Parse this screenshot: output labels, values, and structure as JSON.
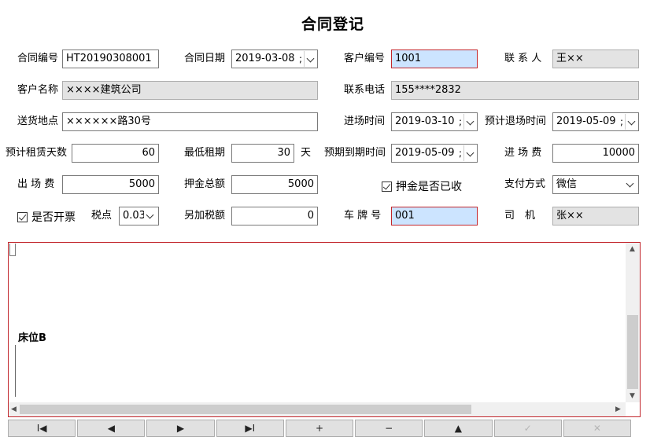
{
  "form": {
    "title": "合同登记",
    "contract_no": {
      "label": "合同编号",
      "value": "HT20190308001"
    },
    "contract_date": {
      "label": "合同日期",
      "value": "2019-03-08"
    },
    "customer_no": {
      "label": "客户编号",
      "value": "1001"
    },
    "contact": {
      "label": "联 系 人",
      "value": "王××"
    },
    "customer_name": {
      "label": "客户名称",
      "value": "××××建筑公司"
    },
    "phone": {
      "label": "联系电话",
      "value": "155****2832"
    },
    "address": {
      "label": "送货地点",
      "value": "××××××路30号"
    },
    "entry_time": {
      "label": "进场时间",
      "value": "2019-03-10"
    },
    "planned_exit": {
      "label": "预计退场时间",
      "value": "2019-05-09"
    },
    "rent_days": {
      "label": "预计租赁天数",
      "value": "60"
    },
    "min_rent": {
      "label": "最低租期",
      "value": "30",
      "unit": "天"
    },
    "due_date": {
      "label": "预期到期时间",
      "value": "2019-05-09"
    },
    "entry_fee": {
      "label": "进 场 费",
      "value": "10000"
    },
    "exit_fee": {
      "label": "出 场 费",
      "value": "5000"
    },
    "deposit": {
      "label": "押金总额",
      "value": "5000"
    },
    "deposit_collected": {
      "label": "押金是否已收",
      "checked": true
    },
    "payment": {
      "label": "支付方式",
      "value": "微信"
    },
    "invoice": {
      "label": "是否开票",
      "checked": true
    },
    "tax_rate": {
      "label": "税点",
      "value": "0.03"
    },
    "extra_tax": {
      "label": "另加税额",
      "value": "0"
    },
    "plate_no": {
      "label": "车 牌 号",
      "value": "001"
    },
    "driver": {
      "label": "司　机",
      "value": "张××"
    },
    "date_sep": ";"
  },
  "memo": {
    "text": "床位B"
  },
  "nav": {
    "first": "I◀",
    "prev": "◀",
    "next": "▶",
    "last": "▶I",
    "insert": "+",
    "delete": "−",
    "edit": "▲",
    "post": "✓",
    "cancel": "✕"
  },
  "colors": {
    "highlight_bg": "#cce4ff",
    "highlight_border": "#c2272d",
    "readonly_bg": "#e3e3e3"
  }
}
